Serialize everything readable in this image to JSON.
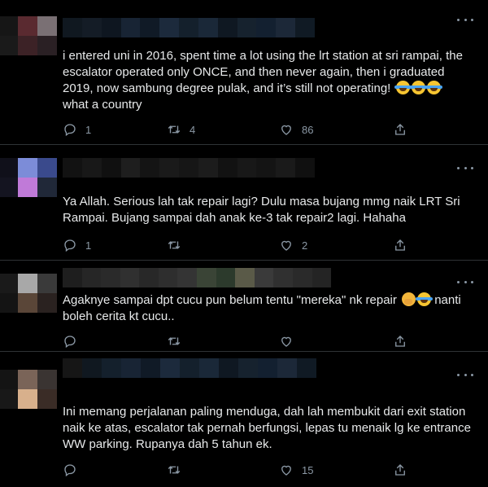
{
  "tweets": [
    {
      "text_parts": [
        "i entered uni in 2016, spent time a lot using the lrt station at sri rampai, the escalator operated only ONCE, and then never again, then i graduated 2019, now sambung degree pulak, and it’s still not operating! ",
        " what a country"
      ],
      "emojis": [
        "face-with-tears-of-joy",
        "face-with-tears-of-joy",
        "face-with-tears-of-joy"
      ],
      "reply_count": "1",
      "retweet_count": "4",
      "like_count": "86",
      "avatar_colors": [
        "#5a2a30",
        "#7a7074",
        "#3c2226",
        "#2a2024"
      ]
    },
    {
      "text_parts": [
        "Ya Allah. Serious lah tak repair lagi? Dulu masa bujang mmg naik LRT Sri Rampai. Bujang sampai dah anak ke-3 tak repair2 lagi. Hahaha"
      ],
      "emojis": [],
      "reply_count": "1",
      "retweet_count": "",
      "like_count": "2",
      "avatar_colors": [
        "#7c8cd8",
        "#3a4a8c",
        "#c07ad8",
        "#202838"
      ]
    },
    {
      "text_parts": [
        "Agaknye sampai dpt cucu pun belum tentu \"mereka\" nk repair ",
        " nanti boleh cerita kt cucu.."
      ],
      "emojis": [
        "shushing-face",
        "face-with-tears-of-joy"
      ],
      "reply_count": "",
      "retweet_count": "",
      "like_count": "",
      "avatar_colors": [
        "#a8a8a8",
        "#3a3a3a",
        "#5a4638",
        "#2a2220"
      ]
    },
    {
      "text_parts": [
        "Ini memang perjalanan paling menduga, dah lah membukit dari exit station naik ke atas, escalator tak pernah berfungsi, lepas tu menaik lg ke entrance WW parking. Rupanya dah 5 tahun ek."
      ],
      "emojis": [],
      "reply_count": "",
      "retweet_count": "",
      "like_count": "15",
      "avatar_colors": [
        "#7a6458",
        "#3a3432",
        "#d8b08c",
        "#3a2c26"
      ]
    }
  ],
  "colors": {
    "background": "#000000",
    "text": "#e7e9ea",
    "icon": "#8b98a5",
    "divider": "#2f3336"
  }
}
